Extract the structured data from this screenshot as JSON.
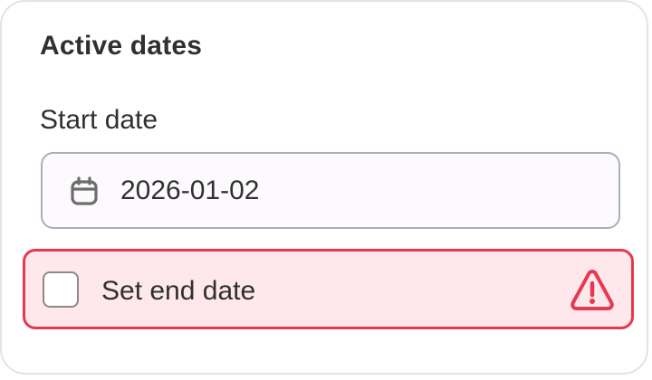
{
  "card": {
    "title": "Active dates"
  },
  "start_date": {
    "label": "Start date",
    "value": "2026-01-02",
    "icon": "calendar-icon"
  },
  "end_date": {
    "checkbox_label": "Set end date",
    "checked": false,
    "state": "error",
    "icon": "warning-icon"
  },
  "colors": {
    "error_border": "#e8384f",
    "error_background": "#fee8eb",
    "text": "#303030",
    "input_border": "#a9aebb"
  }
}
